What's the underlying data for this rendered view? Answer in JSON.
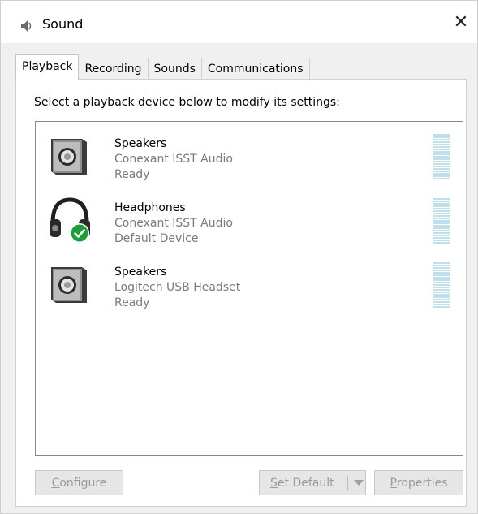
{
  "window": {
    "title": "Sound",
    "close_glyph": "✕"
  },
  "tabs": [
    {
      "label": "Playback",
      "active": true
    },
    {
      "label": "Recording",
      "active": false
    },
    {
      "label": "Sounds",
      "active": false
    },
    {
      "label": "Communications",
      "active": false
    }
  ],
  "instruction": "Select a playback device below to modify its settings:",
  "devices": [
    {
      "name": "Speakers",
      "driver": "Conexant ISST Audio",
      "status": "Ready",
      "icon": "speaker-icon",
      "default": false
    },
    {
      "name": "Headphones",
      "driver": "Conexant ISST Audio",
      "status": "Default Device",
      "icon": "headphones-icon",
      "default": true
    },
    {
      "name": "Speakers",
      "driver": "Logitech USB Headset",
      "status": "Ready",
      "icon": "speaker-icon",
      "default": false
    }
  ],
  "buttons": {
    "configure": {
      "mnemonic": "C",
      "rest": "onfigure"
    },
    "set_default": {
      "mnemonic": "S",
      "rest": "et Default"
    },
    "properties": {
      "mnemonic": "P",
      "rest": "roperties"
    }
  },
  "colors": {
    "default_check": "#1e9e3a",
    "level_meter": "#bfe0ea",
    "disabled_text": "#9a9a9a"
  }
}
